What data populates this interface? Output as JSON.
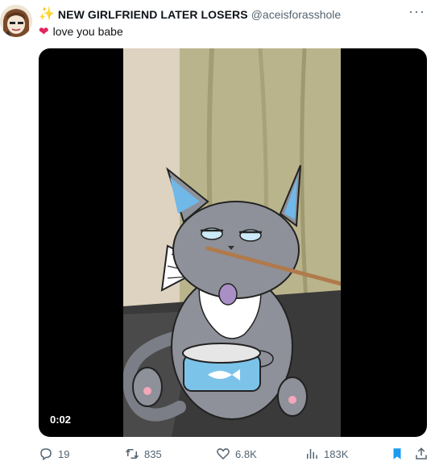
{
  "tweet": {
    "display_name_emoji": "✨",
    "display_name": "NEW GIRLFRIEND LATER LOSERS",
    "handle": "@aceisforasshole",
    "more_label": "···",
    "text_emoji": "❤",
    "text": "love you babe"
  },
  "media": {
    "timestamp": "0:02"
  },
  "actions": {
    "replies": "19",
    "retweets": "835",
    "likes": "6.8K",
    "views": "183K"
  },
  "colors": {
    "accent": "#1d9bf0",
    "muted": "#536471",
    "heart": "#e0245e"
  }
}
